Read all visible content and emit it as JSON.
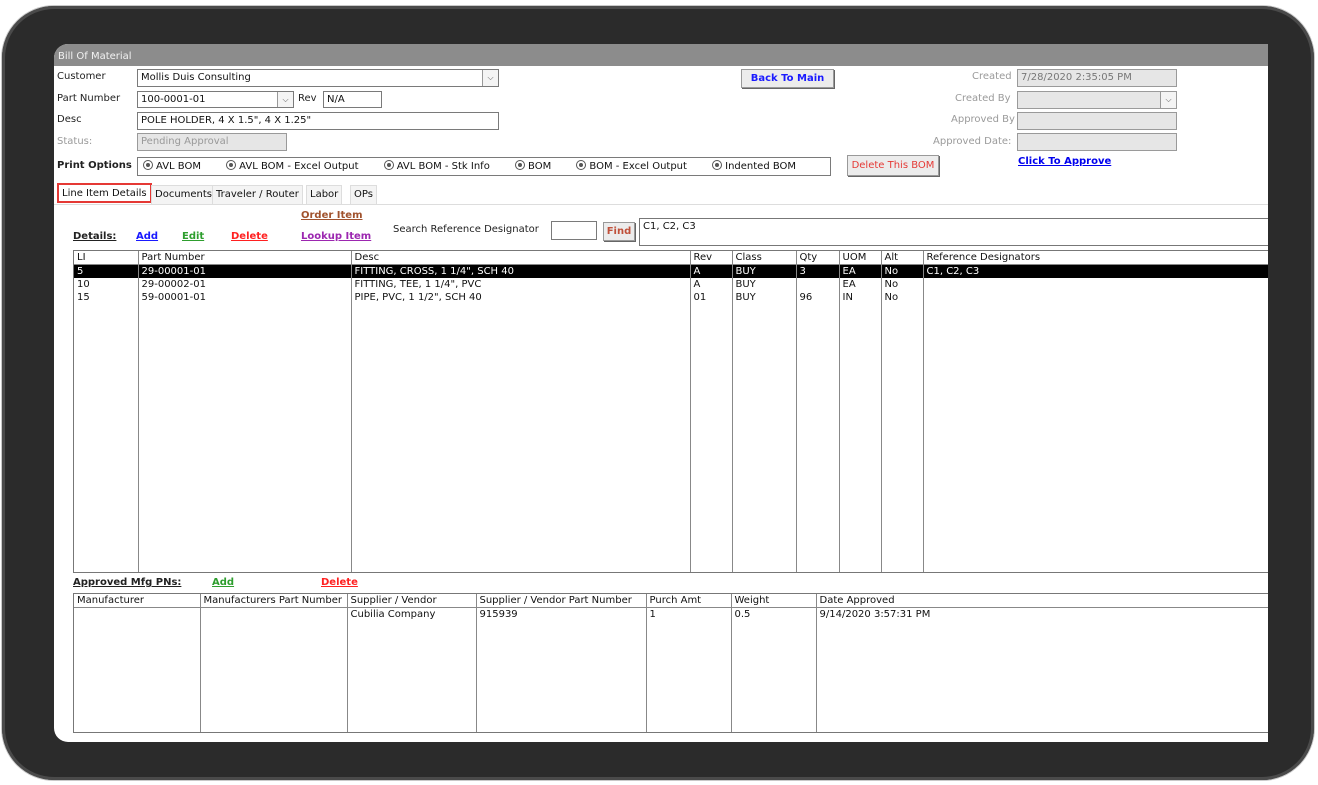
{
  "window": {
    "title": "Bill Of Material"
  },
  "header": {
    "customer_label": "Customer",
    "customer_value": "Mollis Duis Consulting",
    "part_number_label": "Part Number",
    "part_number_value": "100-0001-01",
    "rev_label": "Rev",
    "rev_value": "N/A",
    "desc_label": "Desc",
    "desc_value": "POLE HOLDER, 4 X 1.5\", 4 X 1.25\"",
    "status_label": "Status:",
    "status_value": "Pending Approval",
    "back_to_main": "Back To Main",
    "created_label": "Created",
    "created_value": "7/28/2020 2:35:05 PM",
    "created_by_label": "Created By",
    "created_by_value": "",
    "approved_by_label": "Approved By",
    "approved_by_value": "",
    "approved_date_label": "Approved Date:",
    "approved_date_value": "",
    "click_to_approve": "Click To Approve",
    "delete_bom": "Delete This BOM"
  },
  "print_options": {
    "label": "Print Options",
    "options": [
      "AVL BOM",
      "AVL BOM - Excel Output",
      "AVL BOM - Stk Info",
      "BOM",
      "BOM - Excel Output",
      "Indented BOM"
    ]
  },
  "tabs": [
    "Line Item Details",
    "Documents",
    "Traveler / Router",
    "Labor",
    "OPs"
  ],
  "details": {
    "label": "Details:",
    "add": "Add",
    "edit": "Edit",
    "delete": "Delete",
    "order_item": "Order Item",
    "lookup_item": "Lookup Item",
    "search_label": "Search Reference Designator",
    "search_value": "",
    "find": "Find",
    "ref_designators_value": "C1, C2, C3"
  },
  "colors": {
    "add": "#1a1aff",
    "edit": "#2e9e2e",
    "delete": "#ff2020",
    "order": "#a0522d",
    "lookup": "#9c27b0",
    "approve": "#0000ee"
  },
  "line_items": {
    "columns": [
      "LI",
      "Part Number",
      "Desc",
      "Rev",
      "Class",
      "Qty",
      "UOM",
      "Alt",
      "Reference Designators"
    ],
    "rows": [
      [
        "5",
        "29-00001-01",
        "FITTING, CROSS, 1 1/4\", SCH 40",
        "A",
        "BUY",
        "3",
        "EA",
        "No",
        "C1, C2, C3"
      ],
      [
        "10",
        "29-00002-01",
        "FITTING, TEE, 1 1/4\", PVC",
        "A",
        "BUY",
        "",
        "EA",
        "No",
        ""
      ],
      [
        "15",
        "59-00001-01",
        "PIPE, PVC, 1 1/2\", SCH 40",
        "01",
        "BUY",
        "96",
        "IN",
        "No",
        ""
      ]
    ]
  },
  "approved_mfg": {
    "label": "Approved Mfg PNs:",
    "add": "Add",
    "delete": "Delete",
    "columns": [
      "Manufacturer",
      "Manufacturers Part Number",
      "Supplier / Vendor",
      "Supplier / Vendor Part Number",
      "Purch Amt",
      "Weight",
      "Date Approved"
    ],
    "rows": [
      [
        "",
        "",
        "Cubilia Company",
        "915939",
        "1",
        "0.5",
        "9/14/2020 3:57:31 PM"
      ]
    ]
  }
}
